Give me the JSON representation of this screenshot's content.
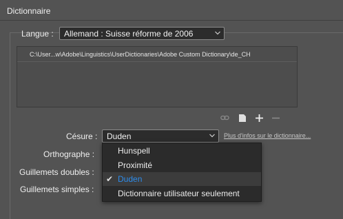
{
  "panel": {
    "title": "Dictionnaire"
  },
  "language": {
    "label": "Langue :",
    "selected": "Allemand : Suisse réforme de 2006"
  },
  "dictionary_list": {
    "items": [
      "C:\\User...w\\Adobe\\Linguistics\\UserDictionaries\\Adobe Custom Dictionary\\de_CH"
    ]
  },
  "toolbar": {
    "icons": [
      "link-icon",
      "document-icon",
      "plus-icon",
      "minus-icon"
    ]
  },
  "hyphenation": {
    "label": "Césure :",
    "selected": "Duden",
    "more_link": "Plus d'infos sur le dictionnaire..."
  },
  "spelling": {
    "label": "Orthographe :"
  },
  "double_quotes": {
    "label": "Guillemets doubles :"
  },
  "single_quotes": {
    "label": "Guillemets simples :"
  },
  "hyphenation_menu": {
    "options": [
      "Hunspell",
      "Proximité",
      "Duden",
      "Dictionnaire utilisateur seulement"
    ],
    "selected_index": 2
  },
  "colors": {
    "background": "#535353",
    "field": "#2c2c2c",
    "menu": "#2b2b2b",
    "selected_text": "#2d8ceb"
  }
}
